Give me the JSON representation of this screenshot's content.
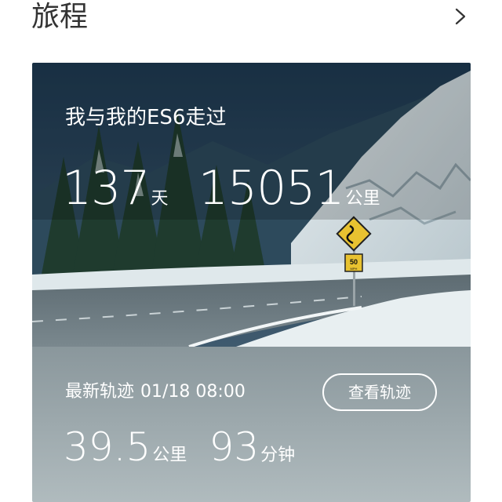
{
  "header": {
    "title": "旅程"
  },
  "card": {
    "title": "我与我的ES6走过",
    "days_value": "137",
    "days_unit": "天",
    "distance_value": "15051",
    "distance_unit": "公里",
    "latest_label": "最新轨迹",
    "latest_time": "01/18 08:00",
    "view_button_label": "查看轨迹",
    "trip_distance_value": "39.5",
    "trip_distance_unit": "公里",
    "trip_duration_value": "93",
    "trip_duration_unit": "分钟",
    "sign_speed": "50",
    "sign_speed_sub": "MPH"
  },
  "colors": {
    "panel_top": "#8a979c",
    "panel_bottom": "#b0bbbe",
    "sign_yellow": "#e8c230"
  }
}
